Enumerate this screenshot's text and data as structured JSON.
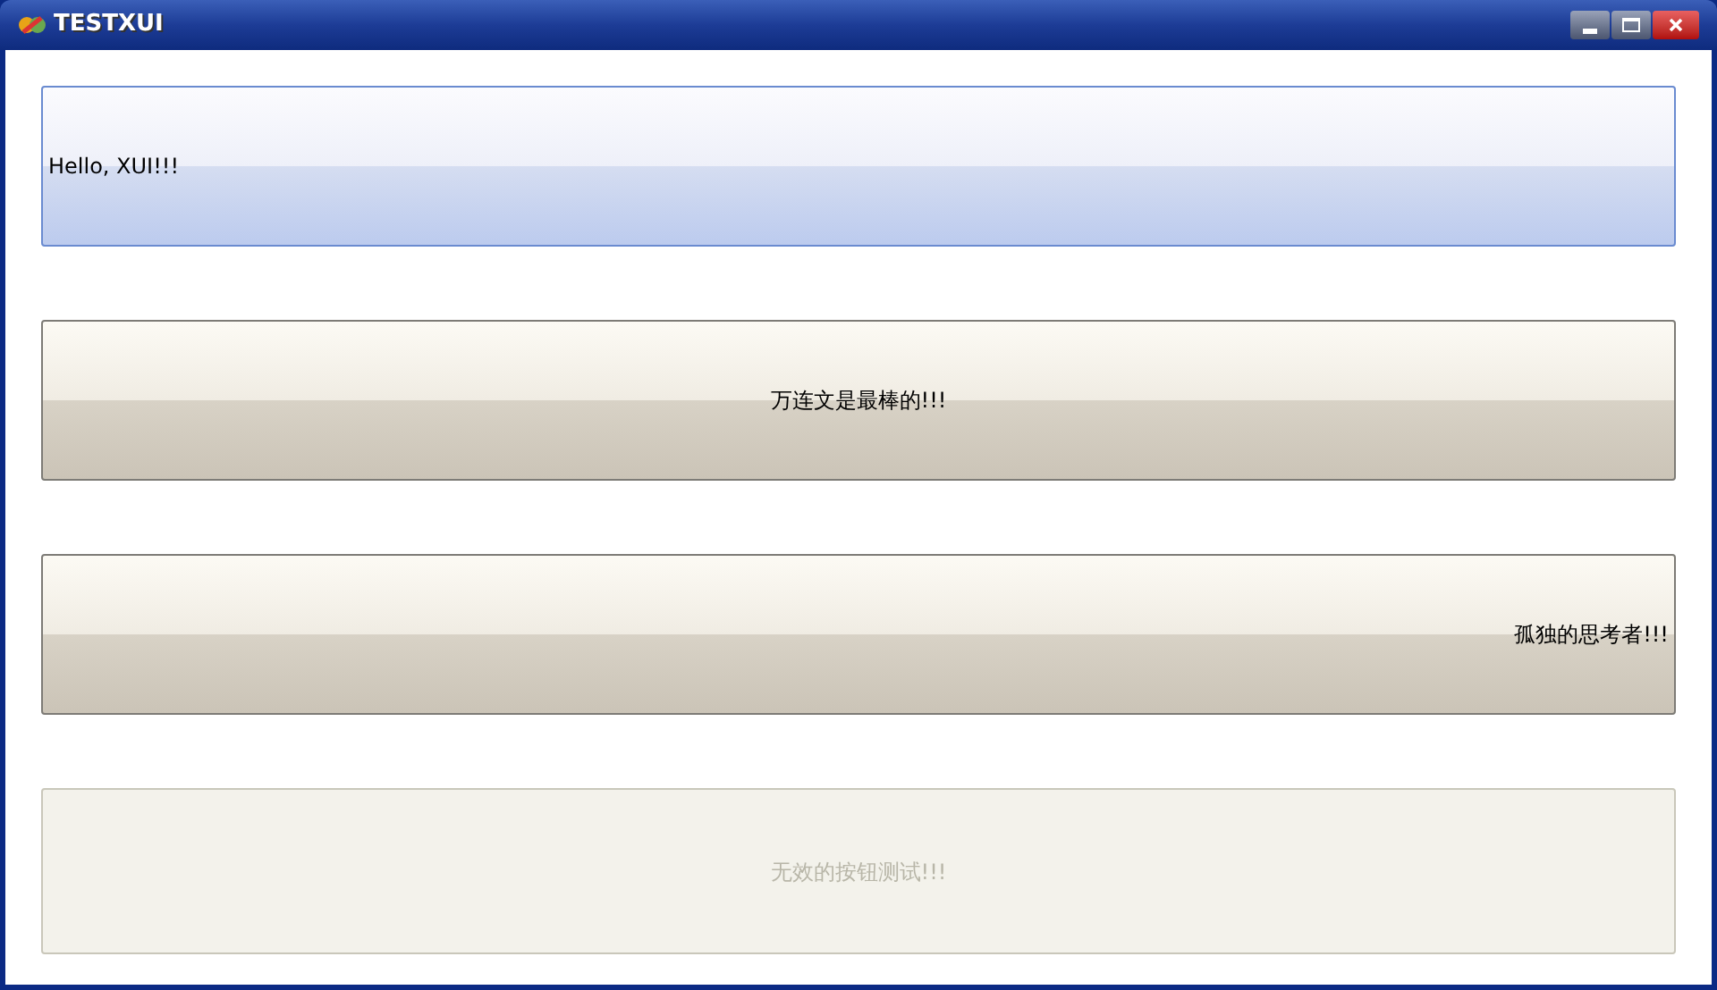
{
  "window": {
    "title": "TESTXUI"
  },
  "buttons": [
    {
      "label": "Hello, XUI!!!",
      "kind": "left",
      "highlighted": true,
      "disabled": false
    },
    {
      "label": "万连文是最棒的!!!",
      "kind": "center",
      "highlighted": false,
      "disabled": false
    },
    {
      "label": "孤独的思考者!!!",
      "kind": "right",
      "highlighted": false,
      "disabled": false
    },
    {
      "label": "无效的按钮测试!!!",
      "kind": "center",
      "highlighted": false,
      "disabled": true
    }
  ]
}
